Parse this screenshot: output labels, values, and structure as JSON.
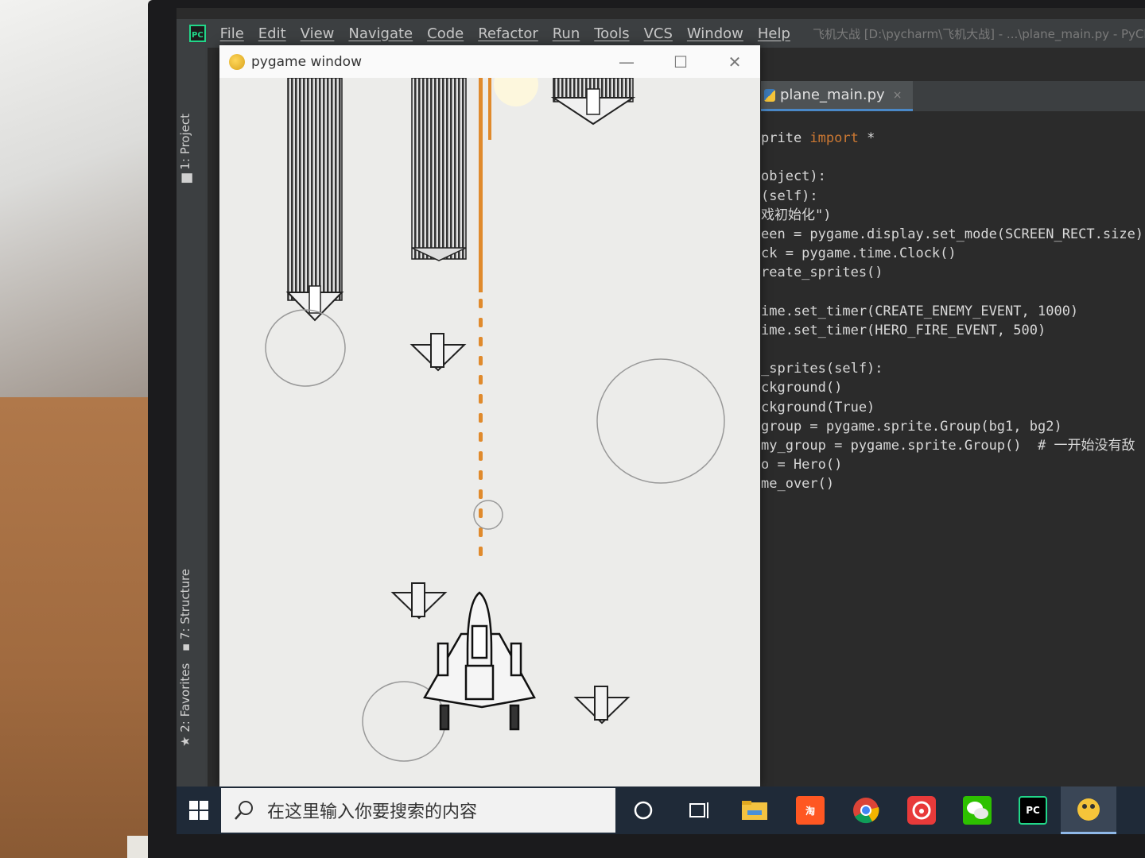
{
  "ide": {
    "menu": [
      "File",
      "Edit",
      "View",
      "Navigate",
      "Code",
      "Refactor",
      "Run",
      "Tools",
      "VCS",
      "Window",
      "Help"
    ],
    "title": "飞机大战 [D:\\pycharm\\飞机大战] - ...\\plane_main.py - PyCha",
    "tool_tabs": {
      "project": "1: Project",
      "structure": "7: Structure",
      "favorites": "2: Favorites"
    }
  },
  "editor": {
    "tab": "plane_main.py",
    "tab_close": "×",
    "lines": [
      {
        "text": "prite ",
        "kw": "import",
        "rest": " *"
      },
      {
        "text": ""
      },
      {
        "text": "object):"
      },
      {
        "text": "(self):"
      },
      {
        "text": "戏初始化\")"
      },
      {
        "text": "een = pygame.display.set_mode(SCREEN_RECT.size)"
      },
      {
        "text": "ck = pygame.time.Clock()"
      },
      {
        "text": "reate_sprites()"
      },
      {
        "text": ""
      },
      {
        "text": "ime.set_timer(CREATE_ENEMY_EVENT, 1000)"
      },
      {
        "text": "ime.set_timer(HERO_FIRE_EVENT, 500)"
      },
      {
        "text": ""
      },
      {
        "text": "_sprites(self):"
      },
      {
        "text": "ckground()"
      },
      {
        "text": "ckground(True)"
      },
      {
        "text": "group = pygame.sprite.Group(bg1, bg2)"
      },
      {
        "text": "my_group = pygame.sprite.Group()  # 一开始没有敌"
      },
      {
        "text": "o = Hero()"
      },
      {
        "text": "me_over()"
      }
    ]
  },
  "pygame_window": {
    "title": "pygame window",
    "controls": {
      "minimize": "—",
      "maximize": "☐",
      "close": "✕"
    }
  },
  "taskbar": {
    "search_placeholder": "在这里输入你要搜索的内容",
    "apps": [
      {
        "name": "cortana",
        "icon": "circle-icon"
      },
      {
        "name": "task-view",
        "icon": "task-view-icon"
      },
      {
        "name": "file-explorer",
        "icon": "folder-icon",
        "color": "#f3c240"
      },
      {
        "name": "taobao",
        "icon": "taobao-icon",
        "label": "淘",
        "color": "#ff5722"
      },
      {
        "name": "chrome",
        "icon": "chrome-icon"
      },
      {
        "name": "netease-music",
        "icon": "music-icon",
        "color": "#e83a3a"
      },
      {
        "name": "wechat",
        "icon": "wechat-icon",
        "color": "#2dc100"
      },
      {
        "name": "pycharm",
        "icon": "pycharm-icon",
        "label": "PC",
        "color": "#21d789"
      },
      {
        "name": "python-game",
        "icon": "pygame-icon",
        "active": true
      }
    ]
  }
}
